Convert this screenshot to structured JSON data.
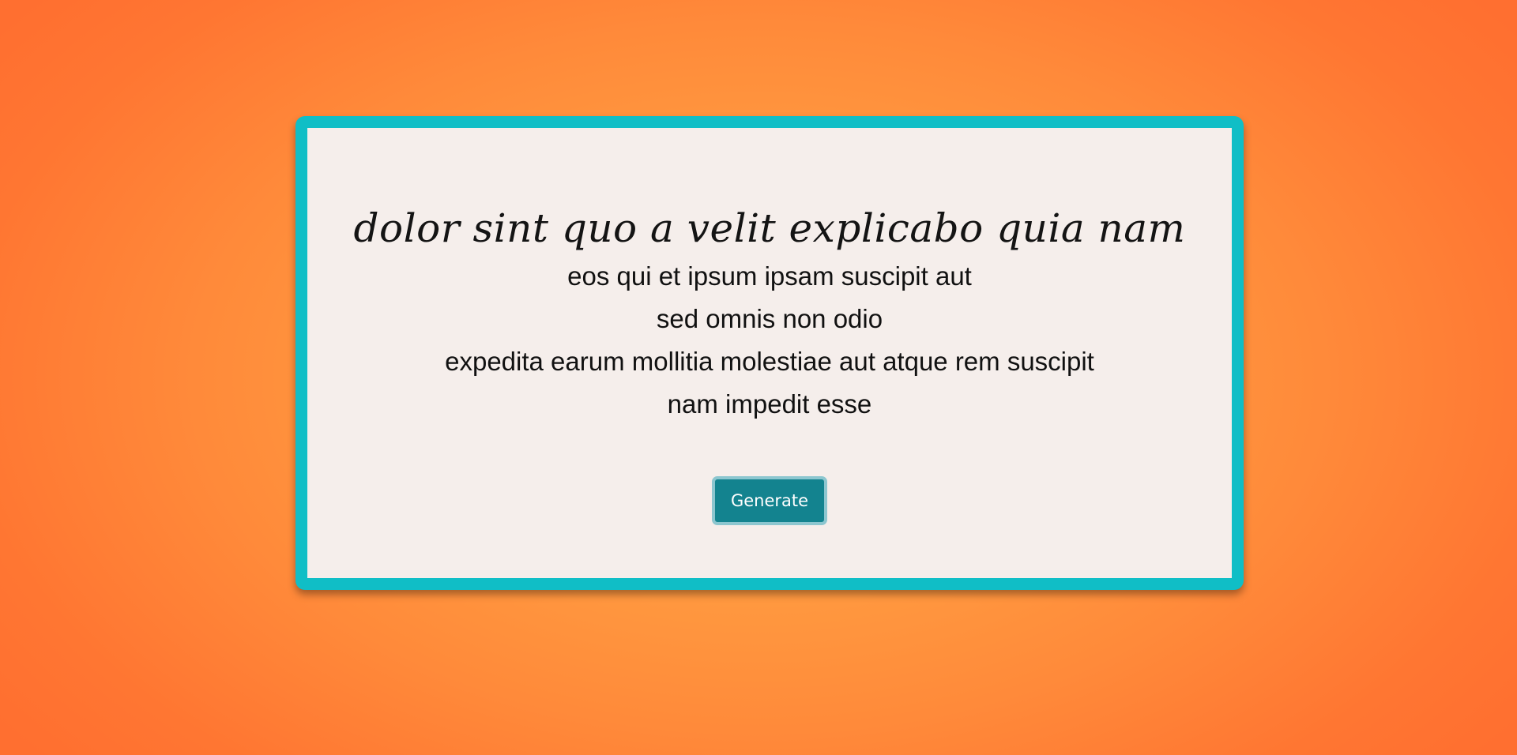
{
  "card": {
    "title": "dolor sint quo a velit explicabo quia nam",
    "lines": [
      "eos qui et ipsum ipsam suscipit aut",
      "sed omnis non odio",
      "expedita earum mollitia molestiae aut atque rem suscipit",
      "nam impedit esse"
    ],
    "button_label": "Generate"
  },
  "colors": {
    "background": "#ff8a3a",
    "card_border": "#10bec6",
    "card_fill": "#f5eeeb",
    "button": "#13838f"
  }
}
